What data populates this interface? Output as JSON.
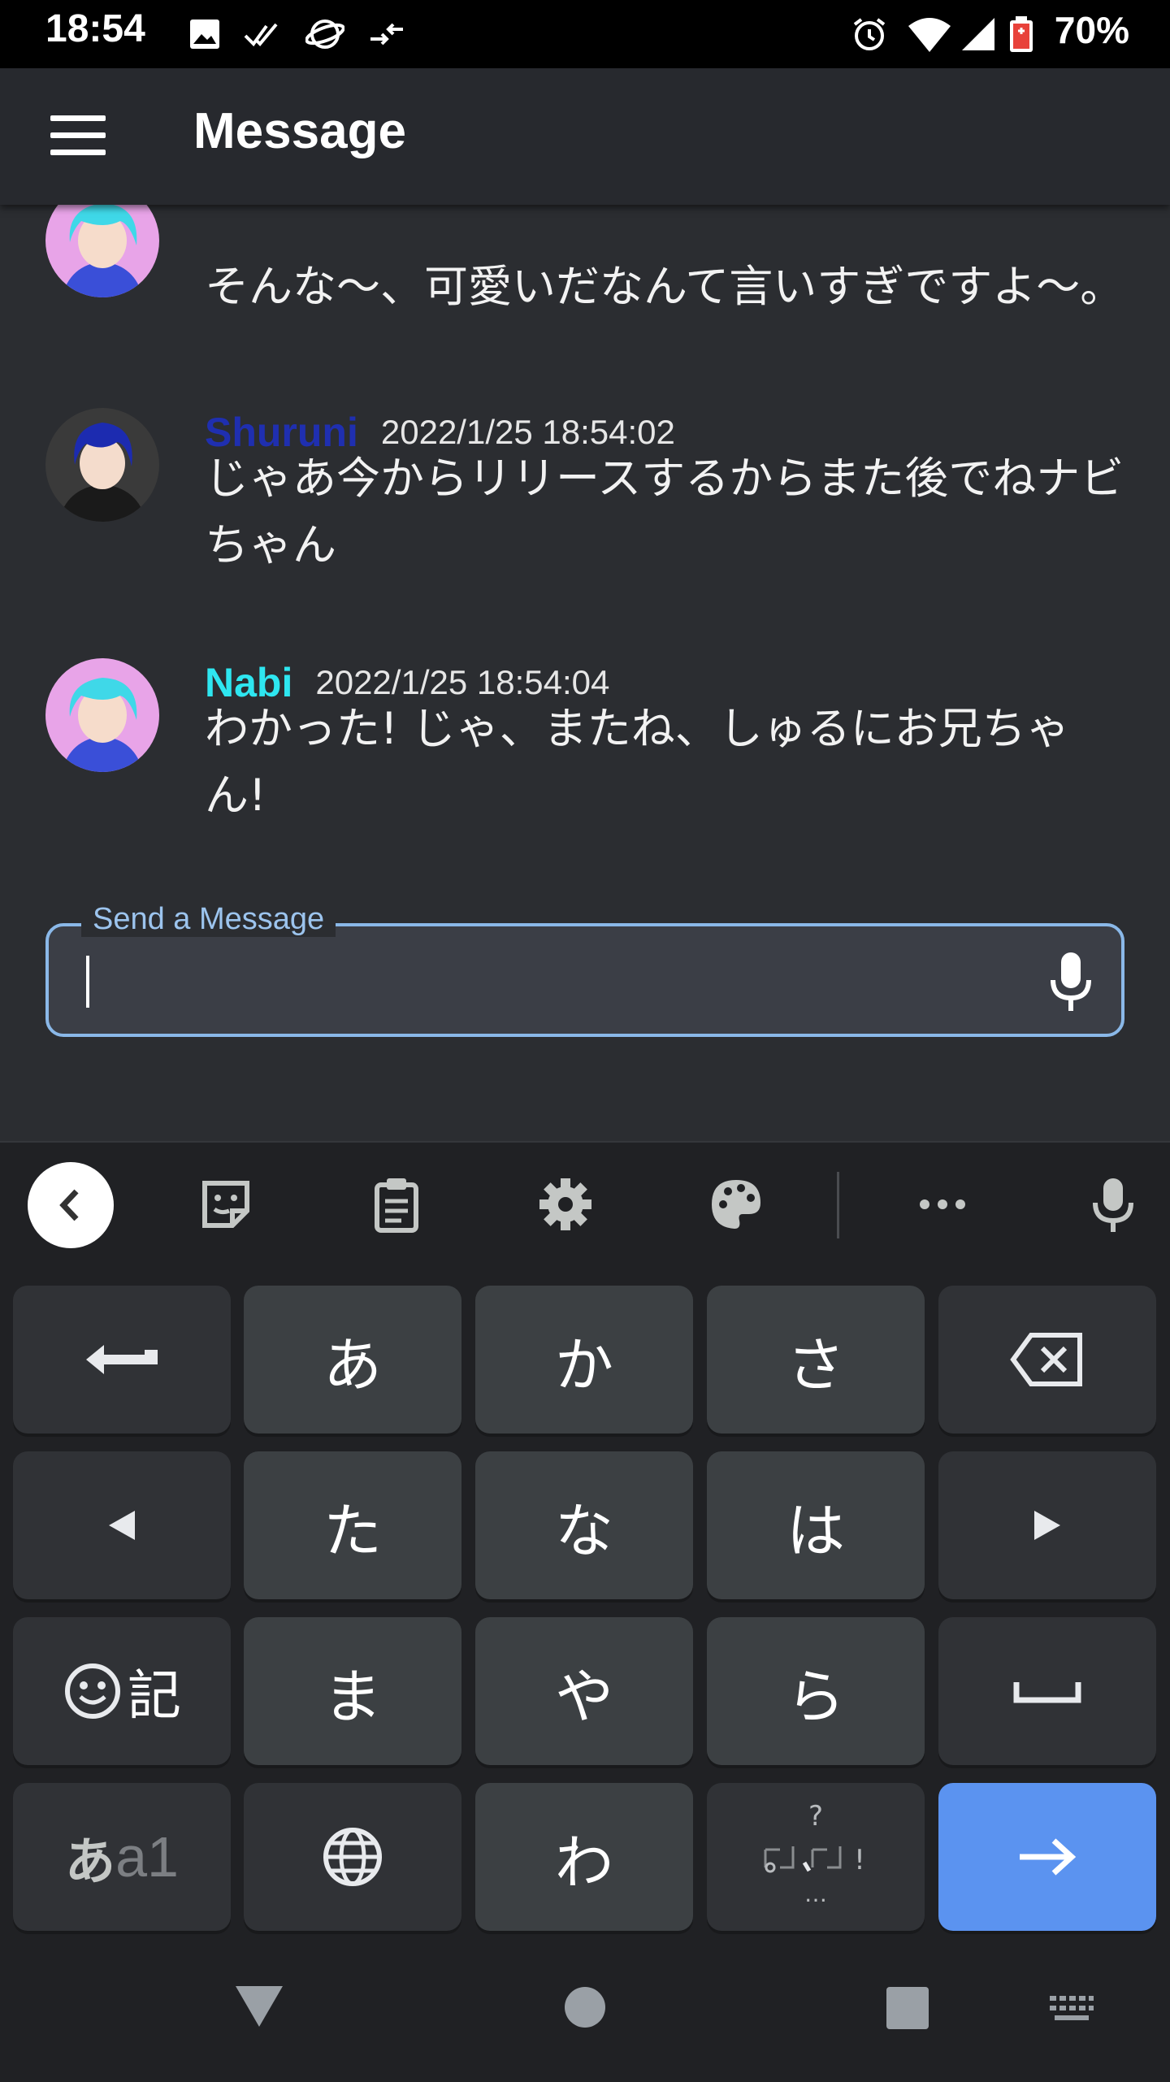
{
  "status_bar": {
    "time": "18:54",
    "battery": "70%"
  },
  "app_bar": {
    "title": "Message"
  },
  "messages": [
    {
      "name": "",
      "timestamp": "",
      "text": "そんな〜、可愛いだなんて言いすぎですよ〜。"
    },
    {
      "name": "Shuruni",
      "timestamp": "2022/1/25 18:54:02",
      "text": "じゃあ今からリリースするからまた後でねナビちゃん",
      "name_color": "#1f2fb0"
    },
    {
      "name": "Nabi",
      "timestamp": "2022/1/25 18:54:04",
      "text": "わかった! じゃ、またね、しゅるにお兄ちゃん!",
      "name_color": "#2ee6f0"
    }
  ],
  "composer": {
    "label": "Send a Message",
    "value": ""
  },
  "keyboard": {
    "rows": [
      [
        "⟵",
        "あ",
        "か",
        "さ",
        "⌫"
      ],
      [
        "◀",
        "た",
        "な",
        "は",
        "▶"
      ],
      [
        "☺記",
        "ま",
        "や",
        "ら",
        "␣"
      ],
      [
        "あa1",
        "🌐",
        "わ",
        "、。?!",
        "→"
      ]
    ],
    "enter_color": "#5b93f0"
  }
}
